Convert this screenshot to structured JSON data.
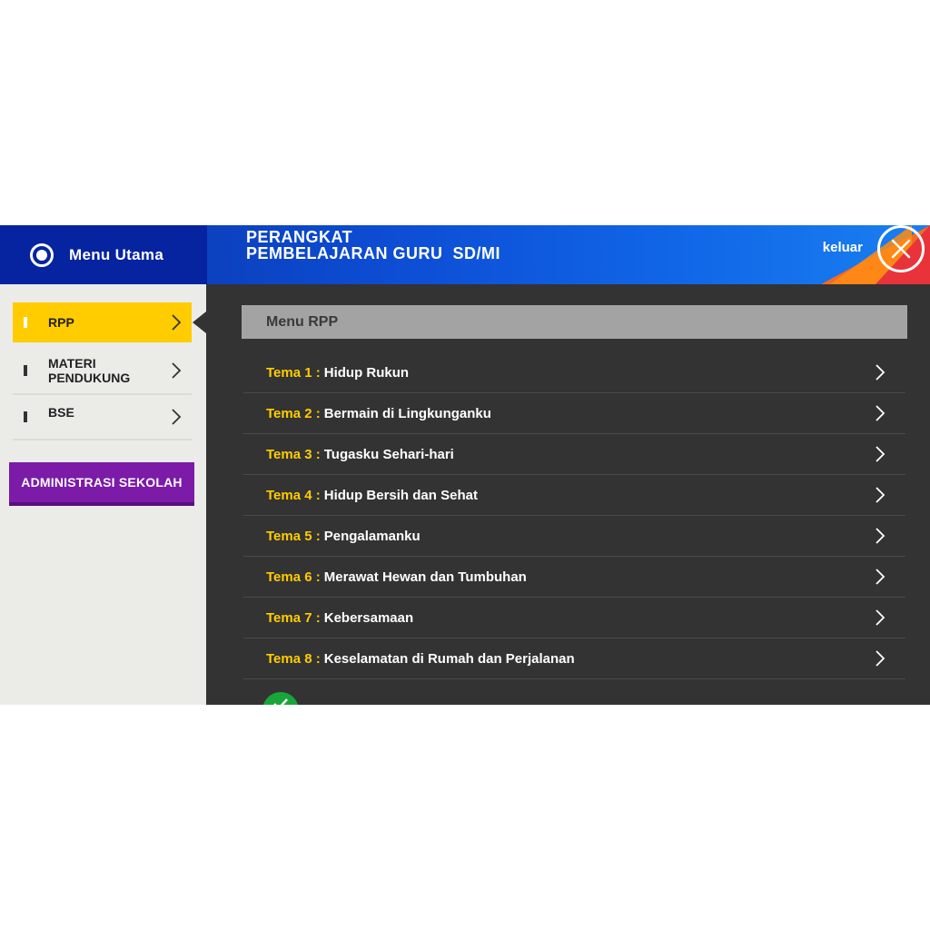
{
  "header": {
    "menu_utama_label": "Menu Utama",
    "title_line1": "PERANGKAT",
    "title_line2": "PEMBELAJARAN GURU  SD/MI",
    "keluar_label": "keluar"
  },
  "sidebar": {
    "items": [
      {
        "label": "RPP",
        "active": true
      },
      {
        "label_line1": "MATERI",
        "label_line2": "PENDUKUNG"
      },
      {
        "label": "BSE"
      }
    ],
    "admin_button_label": "ADMINISTRASI SEKOLAH"
  },
  "main": {
    "section_title": "Menu RPP",
    "tema": [
      {
        "key": "Tema 1 :",
        "name": "Hidup Rukun"
      },
      {
        "key": "Tema 2 :",
        "name": "Bermain di Lingkunganku"
      },
      {
        "key": "Tema 3 :",
        "name": "Tugasku Sehari-hari"
      },
      {
        "key": "Tema 4 :",
        "name": "Hidup Bersih dan Sehat"
      },
      {
        "key": "Tema 5 :",
        "name": "Pengalamanku"
      },
      {
        "key": "Tema 6 :",
        "name": "Merawat Hewan dan Tumbuhan"
      },
      {
        "key": "Tema 7 :",
        "name": "Kebersamaan"
      },
      {
        "key": "Tema 8 :",
        "name": "Keselamatan di Rumah dan Perjalanan"
      }
    ]
  },
  "icons": {
    "menu": "radio-icon",
    "close": "close-icon",
    "chevron": "chevron-right-icon",
    "partial": "check-icon"
  },
  "colors": {
    "header_blue": "#0623a0",
    "accent_yellow": "#ffcc00",
    "admin_purple": "#7b1ba8",
    "panel_dark": "#333333",
    "keluar_orange": "#f36c21",
    "green": "#1aa53a"
  }
}
